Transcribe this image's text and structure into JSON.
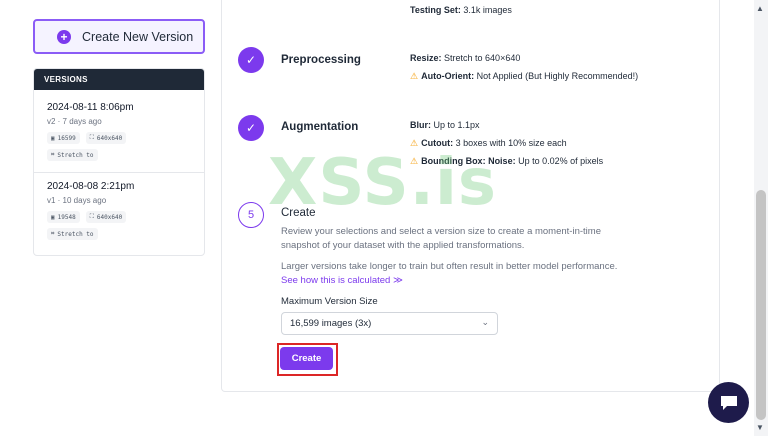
{
  "sidebar": {
    "new_version_label": "Create New Version",
    "versions_header": "VERSIONS",
    "versions": [
      {
        "date": "2024-08-11 8:06pm",
        "sub": "v2 · 7 days ago",
        "images": "16599",
        "size": "640x640",
        "resize": "Stretch to"
      },
      {
        "date": "2024-08-08 2:21pm",
        "sub": "v1 · 10 days ago",
        "images": "19548",
        "size": "640x640",
        "resize": "Stretch to"
      }
    ]
  },
  "main": {
    "testing_set_label": "Testing Set:",
    "testing_set_value": "3.1k images",
    "steps": {
      "preprocessing": {
        "title": "Preprocessing",
        "resize_label": "Resize:",
        "resize_value": "Stretch to 640×640",
        "auto_orient_label": "Auto-Orient:",
        "auto_orient_value": "Not Applied (But Highly Recommended!)"
      },
      "augmentation": {
        "title": "Augmentation",
        "blur_label": "Blur:",
        "blur_value": "Up to 1.1px",
        "cutout_label": "Cutout:",
        "cutout_value": "3 boxes with 10% size each",
        "bbox_noise_label": "Bounding Box: Noise:",
        "bbox_noise_value": "Up to 0.02% of pixels"
      },
      "create": {
        "number": "5",
        "title": "Create",
        "para1": "Review your selections and select a version size to create a moment-in-time snapshot of your dataset with the applied transformations.",
        "para2_text": "Larger versions take longer to train but often result in better model performance.",
        "para2_link": "See how this is calculated ≫",
        "max_size_label": "Maximum Version Size",
        "max_size_value": "16,599 images (3x)",
        "create_button": "Create"
      }
    }
  },
  "watermark": "XSS.is",
  "colors": {
    "accent": "#7c3aed",
    "warning": "#f59e0b",
    "highlight": "#dc2626"
  }
}
